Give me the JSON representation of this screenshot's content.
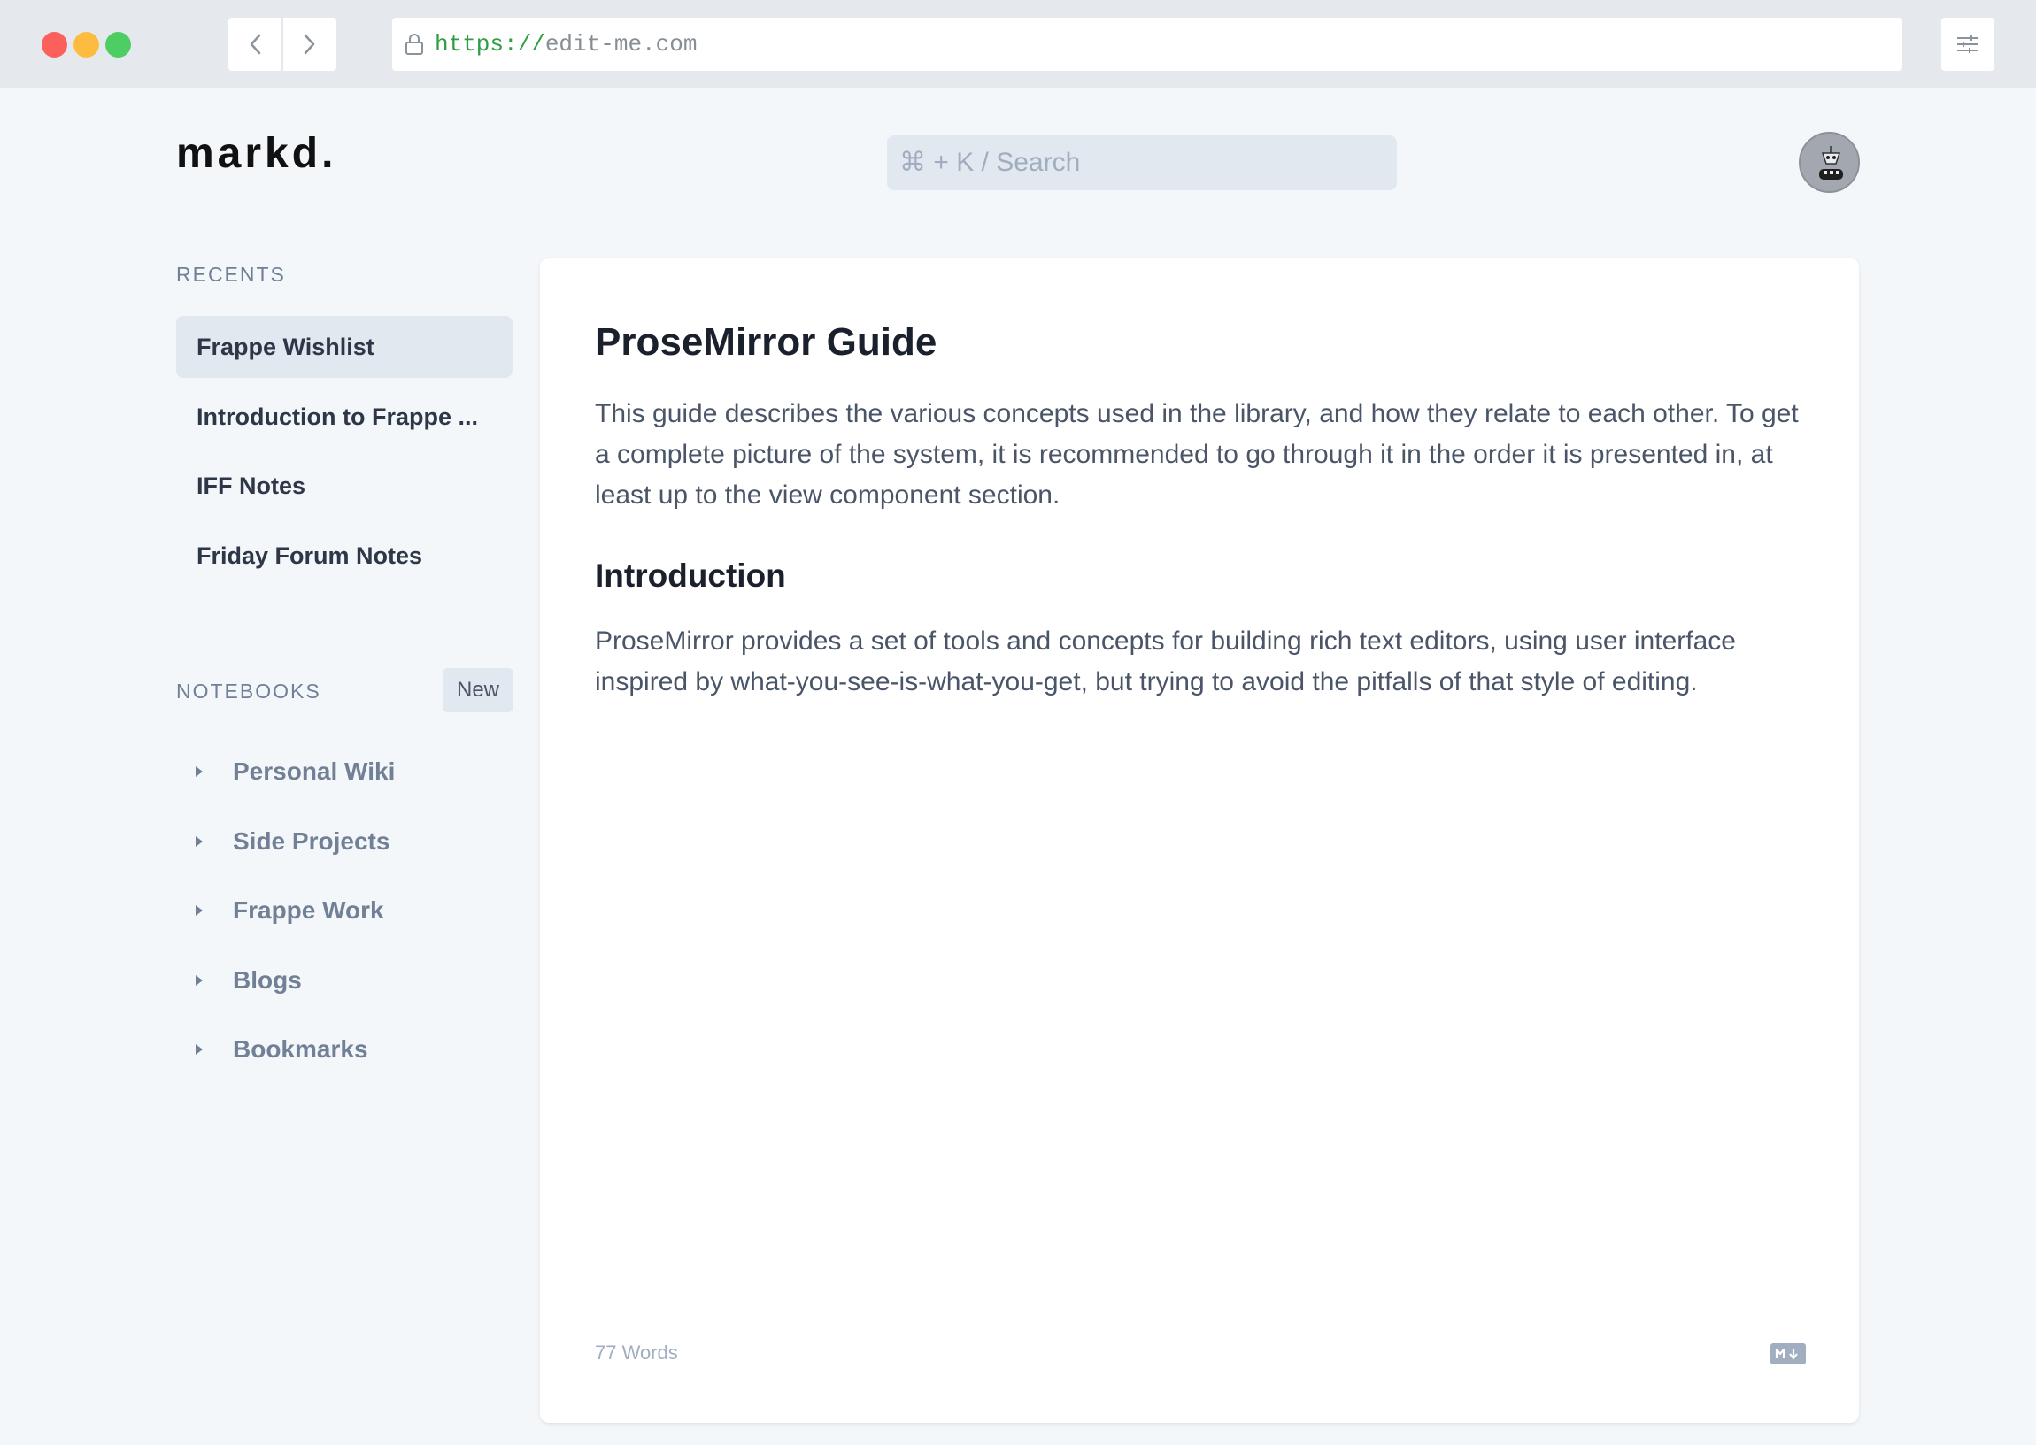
{
  "browser": {
    "url_scheme": "https://",
    "url_host": "edit-me.com",
    "icons": {
      "back": "chevron-left-icon",
      "forward": "chevron-right-icon",
      "lock": "lock-icon",
      "settings": "sliders-icon"
    }
  },
  "app": {
    "logo": "markd.",
    "search_placeholder": "⌘ + K / Search"
  },
  "sidebar": {
    "recents_label": "RECENTS",
    "recents": [
      {
        "label": "Frappe Wishlist",
        "active": true
      },
      {
        "label": "Introduction to Frappe ...",
        "active": false
      },
      {
        "label": "IFF Notes",
        "active": false
      },
      {
        "label": "Friday Forum Notes",
        "active": false
      }
    ],
    "notebooks_label": "NOTEBOOKS",
    "new_label": "New",
    "notebooks": [
      {
        "label": "Personal Wiki"
      },
      {
        "label": "Side Projects"
      },
      {
        "label": "Frappe Work"
      },
      {
        "label": "Blogs"
      },
      {
        "label": "Bookmarks"
      }
    ]
  },
  "document": {
    "title": "ProseMirror Guide",
    "paragraph_1": "This guide describes the various concepts used in the library, and how they relate to each other. To get a complete picture of the system, it is recommended to go through it in the order it is presented in, at least up to the view component section.",
    "heading_2": "Introduction",
    "paragraph_2": "ProseMirror provides a set of tools and concepts for building rich text editors, using user interface inspired by what-you-see-is-what-you-get, but trying to avoid the pitfalls of that style of editing.",
    "word_count": "77 Words",
    "format_icon": "markdown-icon"
  },
  "colors": {
    "active_item_bg": "#e2e8f0",
    "muted_text": "#718096",
    "url_scheme": "#2f9e44",
    "traffic_red": "#fc605c",
    "traffic_yellow": "#fdbc40",
    "traffic_green": "#34c84a"
  }
}
